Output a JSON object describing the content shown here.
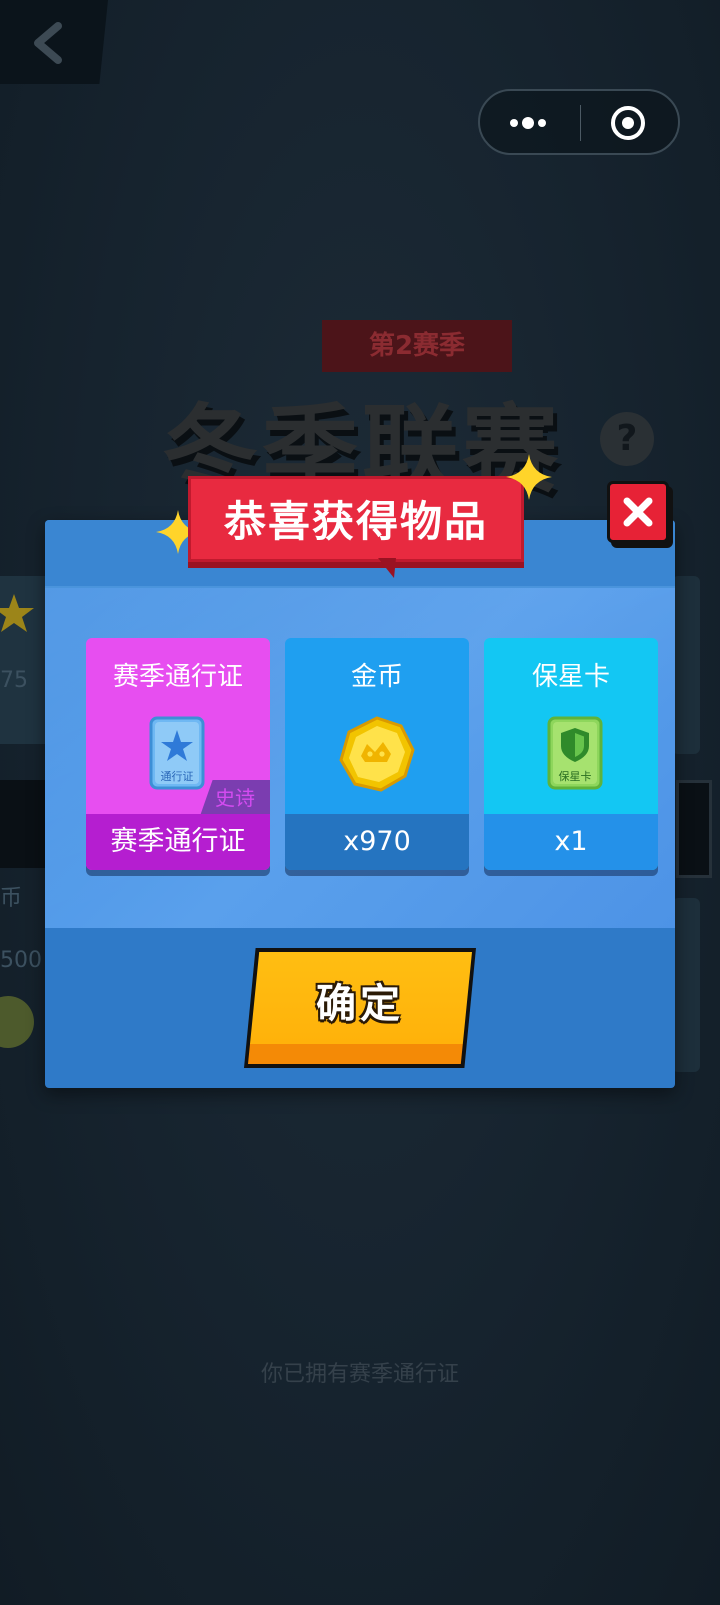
{
  "background": {
    "season_label": "第2赛季",
    "title": "冬季联赛",
    "help_symbol": "?",
    "left_number_top": "75",
    "left_number_bottom": "500",
    "left_char": "币",
    "footnote": "你已拥有赛季通行证"
  },
  "capsule": {
    "more_icon": "more-dots-icon",
    "close_icon": "target-circle-icon"
  },
  "dialog": {
    "title": "恭喜获得物品",
    "close_icon": "close-x-icon",
    "items": [
      {
        "name": "赛季通行证",
        "icon": "season-pass-card-icon",
        "icon_text": "通行证",
        "rarity": "史诗",
        "footer": "赛季通行证",
        "color": "#e74ef0"
      },
      {
        "name": "金币",
        "icon": "gold-coin-icon",
        "footer": "x970",
        "color": "#1f9ff0"
      },
      {
        "name": "保星卡",
        "icon": "star-protect-card-icon",
        "icon_text": "保星卡",
        "footer": "x1",
        "color": "#13c7f3"
      }
    ],
    "confirm_label": "确定"
  }
}
